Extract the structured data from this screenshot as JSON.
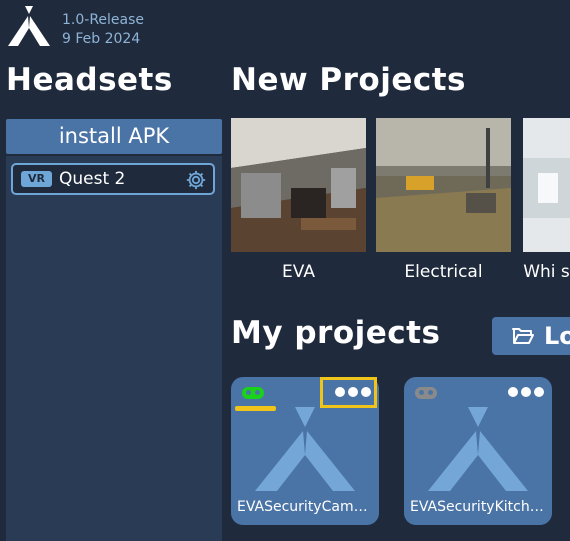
{
  "app": {
    "version": "1.0-Release",
    "date": "9 Feb 2024",
    "logo_icon": "eva-logo-icon"
  },
  "headsets": {
    "title": "Headsets",
    "install_label": "install APK",
    "devices": [
      {
        "badge": "VR",
        "name": "Quest 2",
        "settings_icon": "gear-icon"
      }
    ]
  },
  "new_projects": {
    "title": "New Projects",
    "items": [
      {
        "label": "EVA"
      },
      {
        "label": "Electrical"
      },
      {
        "label": "Whi s"
      }
    ]
  },
  "my_projects": {
    "title": "My projects",
    "load_label": "Lo",
    "load_icon": "folder-open-icon",
    "items": [
      {
        "title": "EVASecurityCamb…",
        "status_color": "#19d219",
        "status": "connected"
      },
      {
        "title": "EVASecurityKitch…",
        "status_color": "#8a8a8a",
        "status": "disconnected"
      }
    ]
  },
  "colors": {
    "background": "#1f2b3d",
    "accent": "#4b74a6",
    "highlight": "#f0c419",
    "version_text": "#8fb3d6"
  }
}
